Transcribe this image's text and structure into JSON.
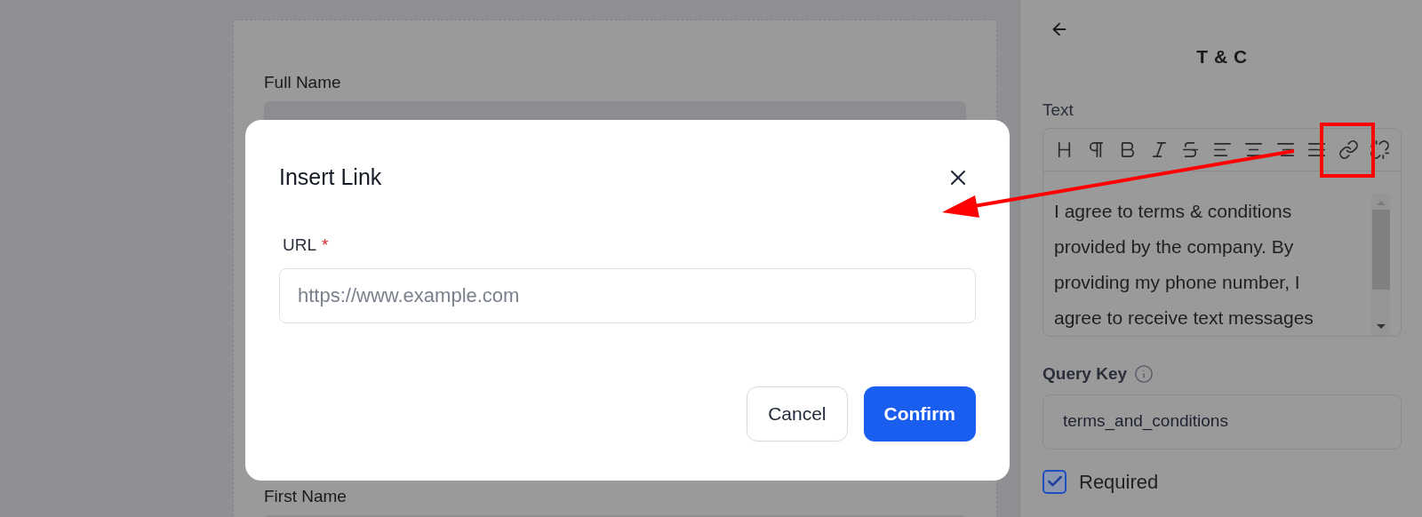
{
  "form": {
    "fields": [
      {
        "label": "Full Name"
      },
      {
        "label": "First Name"
      }
    ]
  },
  "dialog": {
    "title": "Insert Link",
    "field": {
      "label": "URL",
      "required_mark": "*",
      "placeholder": "https://www.example.com"
    },
    "buttons": [
      {
        "label": "Cancel",
        "kind": "secondary"
      },
      {
        "label": "Confirm",
        "kind": "primary"
      }
    ]
  },
  "panel": {
    "title": "T & C",
    "text_label": "Text",
    "toolbar": [
      {
        "kind": "heading"
      },
      {
        "kind": "paragraph"
      },
      {
        "kind": "bold"
      },
      {
        "kind": "italic"
      },
      {
        "kind": "strike"
      },
      {
        "kind": "align-left"
      },
      {
        "kind": "align-center"
      },
      {
        "kind": "align-right"
      },
      {
        "kind": "align-justify"
      },
      {
        "kind": "link"
      },
      {
        "kind": "unlink"
      }
    ],
    "text_lines": [
      "I agree to terms & conditions",
      "provided by the company. By",
      "providing my phone number, I",
      "agree to receive text messages"
    ],
    "query_key": {
      "label": "Query Key",
      "value": "terms_and_conditions"
    },
    "required": {
      "label": "Required",
      "checked": true
    }
  }
}
